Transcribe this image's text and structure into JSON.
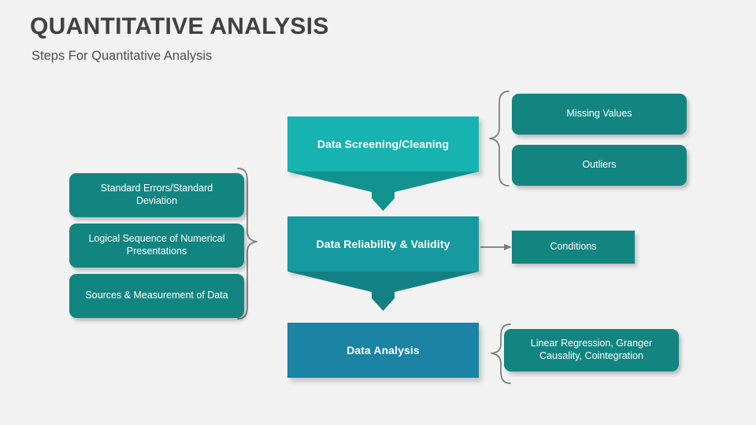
{
  "header": {
    "title": "QUANTITATIVE ANALYSIS",
    "subtitle": "Steps For Quantitative Analysis"
  },
  "colors": {
    "background": "#f2f2f2",
    "title_text": "#404040",
    "subtitle_text": "#4d4d4d",
    "step1": "#17b3b0",
    "step1_arrow": "#13938f",
    "step2": "#169aa0",
    "step2_arrow": "#128185",
    "step3": "#1b83a4",
    "satellite": "#128581",
    "connector": "#7a7a7a",
    "label_text": "#ffffff"
  },
  "steps": [
    {
      "id": "data-screening-cleaning",
      "label": "Data Screening/Cleaning"
    },
    {
      "id": "data-reliability-validity",
      "label": "Data Reliability & Validity"
    },
    {
      "id": "data-analysis",
      "label": "Data Analysis"
    }
  ],
  "right_branch_1": {
    "items": [
      {
        "id": "missing-values",
        "label": "Missing Values"
      },
      {
        "id": "outliers",
        "label": "Outliers"
      }
    ]
  },
  "right_branch_2": {
    "items": [
      {
        "id": "conditions",
        "label": "Conditions"
      }
    ]
  },
  "right_branch_3": {
    "items": [
      {
        "id": "methods",
        "label": "Linear Regression, Granger Causality, Cointegration"
      }
    ]
  },
  "left_branch": {
    "items": [
      {
        "id": "standard-errors",
        "label": "Standard Errors/Standard Deviation"
      },
      {
        "id": "logical-sequence",
        "label": "Logical Sequence of Numerical Presentations"
      },
      {
        "id": "sources-measurement",
        "label": "Sources & Measurement of Data"
      }
    ]
  },
  "icons": {
    "brace_right": "curly-brace-right",
    "brace_left": "curly-brace-left",
    "arrow_right": "arrow-right",
    "arrow_down": "arrow-down"
  }
}
